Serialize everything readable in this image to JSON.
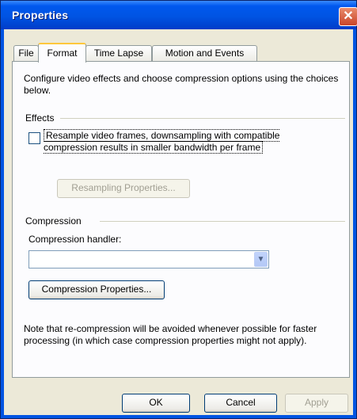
{
  "window": {
    "title": "Properties",
    "close_glyph": "✕"
  },
  "tabs": [
    {
      "label": "File",
      "selected": false
    },
    {
      "label": "Format",
      "selected": true
    },
    {
      "label": "Time Lapse",
      "selected": false
    },
    {
      "label": "Motion and Events",
      "selected": false
    }
  ],
  "panel": {
    "intro": "Configure video effects and choose compression options using the choices below.",
    "effects": {
      "group_label": "Effects",
      "resample_checkbox_label": "Resample video frames, downsampling with compatible compression results in smaller bandwidth per frame",
      "resample_checked": false,
      "resampling_button": "Resampling Properties..."
    },
    "compression": {
      "group_label": "Compression",
      "handler_label": "Compression handler:",
      "handler_value": "",
      "properties_button": "Compression Properties...",
      "note": "Note that re-compression will be avoided whenever possible for faster processing (in which case compression properties might not apply)."
    }
  },
  "buttons": {
    "ok": "OK",
    "cancel": "Cancel",
    "apply": "Apply"
  },
  "icons": {
    "dropdown": "chevron-down-icon"
  },
  "colors": {
    "title_bar": "#0054e3",
    "face": "#ece9d8",
    "tab_highlight": "#ffc83c"
  }
}
